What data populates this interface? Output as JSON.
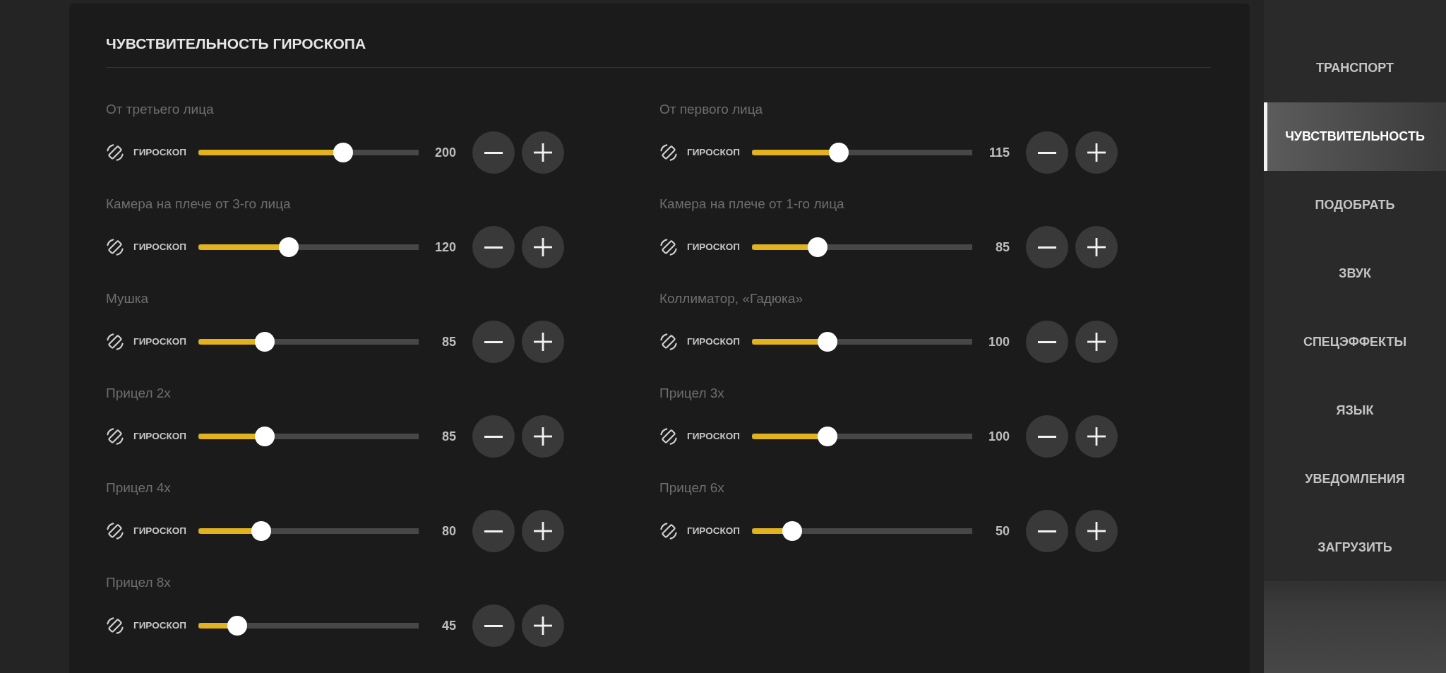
{
  "panel": {
    "title": "ЧУВСТВИТЕЛЬНОСТЬ ГИРОСКОПА",
    "settings": [
      {
        "label": "От третьего лица",
        "control_label": "ГИРОСКОП",
        "level": 0.657,
        "value": "200"
      },
      {
        "label": "От первого лица",
        "control_label": "ГИРОСКОП",
        "level": 0.393,
        "value": "115"
      },
      {
        "label": "Камера на плече от 3-го лица",
        "control_label": "ГИРОСКОП",
        "level": 0.41,
        "value": "120"
      },
      {
        "label": "Камера на плече от 1-го лица",
        "control_label": "ГИРОСКОП",
        "level": 0.297,
        "value": "85"
      },
      {
        "label": "Мушка",
        "control_label": "ГИРОСКОП",
        "level": 0.3,
        "value": "85"
      },
      {
        "label": "Коллиматор, «Гадюка»",
        "control_label": "ГИРОСКОП",
        "level": 0.343,
        "value": "100"
      },
      {
        "label": "Прицел 2x",
        "control_label": "ГИРОСКОП",
        "level": 0.3,
        "value": "85"
      },
      {
        "label": "Прицел 3x",
        "control_label": "ГИРОСКОП",
        "level": 0.343,
        "value": "100"
      },
      {
        "label": "Прицел 4x",
        "control_label": "ГИРОСКОП",
        "level": 0.285,
        "value": "80"
      },
      {
        "label": "Прицел 6x",
        "control_label": "ГИРОСКОП",
        "level": 0.184,
        "value": "50"
      },
      {
        "label": "Прицел 8x",
        "control_label": "ГИРОСКОП",
        "level": 0.176,
        "value": "45"
      }
    ]
  },
  "sidebar": {
    "items": [
      {
        "label": "ТРАНСПОРТ",
        "selected": false
      },
      {
        "label": "ЧУВСТВИТЕЛЬНОСТЬ",
        "selected": true
      },
      {
        "label": "ПОДОБРАТЬ",
        "selected": false
      },
      {
        "label": "ЗВУК",
        "selected": false
      },
      {
        "label": "СПЕЦЭФФЕКТЫ",
        "selected": false
      },
      {
        "label": "ЯЗЫК",
        "selected": false
      },
      {
        "label": "УВЕДОМЛЕНИЯ",
        "selected": false
      },
      {
        "label": "ЗАГРУЗИТЬ",
        "selected": false
      }
    ]
  }
}
